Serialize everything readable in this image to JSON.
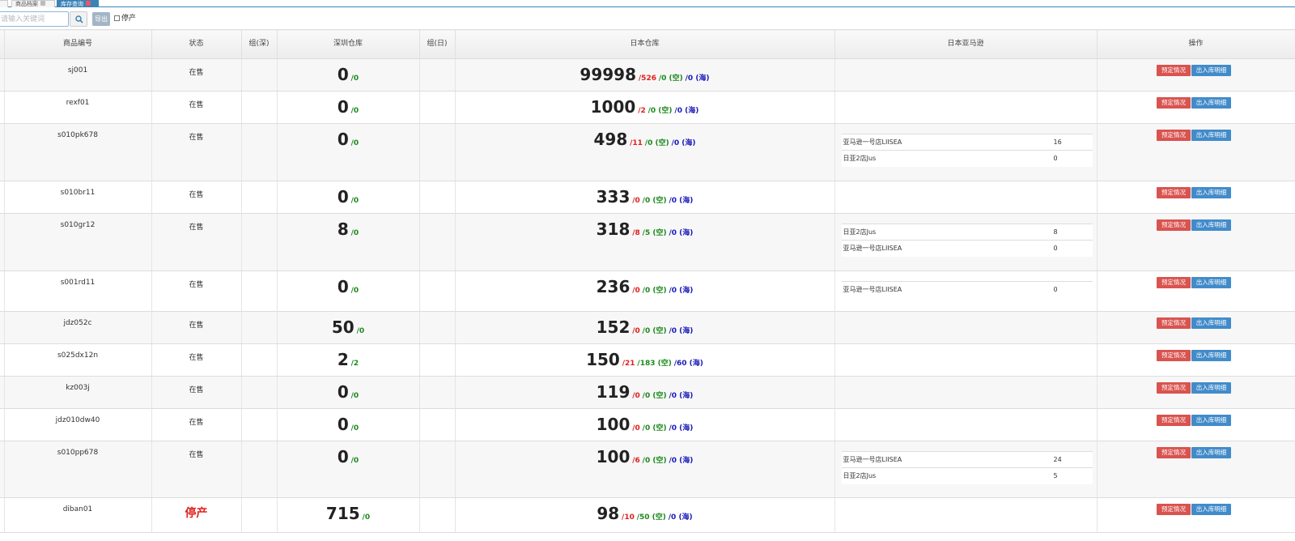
{
  "tabs": [
    {
      "label": "页"
    },
    {
      "label": "商品档案"
    },
    {
      "label": "库存查询"
    }
  ],
  "toolbar": {
    "search_placeholder": "请输入关键词",
    "export_label": "导出",
    "stopped_label": "停产"
  },
  "columns": {
    "code": "商品编号",
    "status": "状态",
    "group_sz": "组(深)",
    "sz_warehouse": "深圳仓库",
    "group_jp": "组(日)",
    "jp_warehouse": "日本仓库",
    "jp_amazon": "日本亚马逊",
    "ops": "操作"
  },
  "buttons": {
    "reserve": "预定情况",
    "io_detail": "出入库明细"
  },
  "rows": [
    {
      "code": "sj001",
      "status": "在售",
      "sz": "0",
      "sz_sub": "/0",
      "jp": "99998",
      "jp_red": "/526",
      "jp_air": "/0 (空)",
      "jp_sea": "/0 (海)",
      "amazon": []
    },
    {
      "code": "rexf01",
      "status": "在售",
      "sz": "0",
      "sz_sub": "/0",
      "jp": "1000",
      "jp_red": "/2",
      "jp_air": "/0 (空)",
      "jp_sea": "/0 (海)",
      "amazon": []
    },
    {
      "code": "s010pk678",
      "status": "在售",
      "sz": "0",
      "sz_sub": "/0",
      "jp": "498",
      "jp_red": "/11",
      "jp_air": "/0 (空)",
      "jp_sea": "/0 (海)",
      "amazon": [
        {
          "shop": "亚马逊一号店LIISEA",
          "qty": "16"
        },
        {
          "shop": "日亚2店Jus",
          "qty": "0"
        }
      ]
    },
    {
      "code": "s010br11",
      "status": "在售",
      "sz": "0",
      "sz_sub": "/0",
      "jp": "333",
      "jp_red": "/0",
      "jp_air": "/0 (空)",
      "jp_sea": "/0 (海)",
      "amazon": []
    },
    {
      "code": "s010gr12",
      "status": "在售",
      "sz": "8",
      "sz_sub": "/0",
      "jp": "318",
      "jp_red": "/8",
      "jp_air": "/5 (空)",
      "jp_sea": "/0 (海)",
      "amazon": [
        {
          "shop": "日亚2店Jus",
          "qty": "8"
        },
        {
          "shop": "亚马逊一号店LIISEA",
          "qty": "0"
        }
      ]
    },
    {
      "code": "s001rd11",
      "status": "在售",
      "sz": "0",
      "sz_sub": "/0",
      "jp": "236",
      "jp_red": "/0",
      "jp_air": "/0 (空)",
      "jp_sea": "/0 (海)",
      "amazon": [
        {
          "shop": "亚马逊一号店LIISEA",
          "qty": "0"
        }
      ]
    },
    {
      "code": "jdz052c",
      "status": "在售",
      "sz": "50",
      "sz_sub": "/0",
      "jp": "152",
      "jp_red": "/0",
      "jp_air": "/0 (空)",
      "jp_sea": "/0 (海)",
      "amazon": []
    },
    {
      "code": "s025dx12n",
      "status": "在售",
      "sz": "2",
      "sz_sub": "/2",
      "jp": "150",
      "jp_red": "/21",
      "jp_air": "/183 (空)",
      "jp_sea": "/60 (海)",
      "amazon": []
    },
    {
      "code": "kz003j",
      "status": "在售",
      "sz": "0",
      "sz_sub": "/0",
      "jp": "119",
      "jp_red": "/0",
      "jp_air": "/0 (空)",
      "jp_sea": "/0 (海)",
      "amazon": []
    },
    {
      "code": "jdz010dw40",
      "status": "在售",
      "sz": "0",
      "sz_sub": "/0",
      "jp": "100",
      "jp_red": "/0",
      "jp_air": "/0 (空)",
      "jp_sea": "/0 (海)",
      "amazon": []
    },
    {
      "code": "s010pp678",
      "status": "在售",
      "sz": "0",
      "sz_sub": "/0",
      "jp": "100",
      "jp_red": "/6",
      "jp_air": "/0 (空)",
      "jp_sea": "/0 (海)",
      "amazon": [
        {
          "shop": "亚马逊一号店LIISEA",
          "qty": "24"
        },
        {
          "shop": "日亚2店Jus",
          "qty": "5"
        }
      ]
    },
    {
      "code": "diban01",
      "status": "停产",
      "stopped": true,
      "sz": "715",
      "sz_sub": "/0",
      "jp": "98",
      "jp_red": "/10",
      "jp_air": "/50 (空)",
      "jp_sea": "/0 (海)",
      "amazon": []
    }
  ],
  "colors": {
    "accent": "#3a83b6",
    "reserve_btn": "#d9534f",
    "io_btn": "#428bca",
    "red": "#e02020",
    "green": "#1d8a1d",
    "blue": "#1a1ab8"
  }
}
